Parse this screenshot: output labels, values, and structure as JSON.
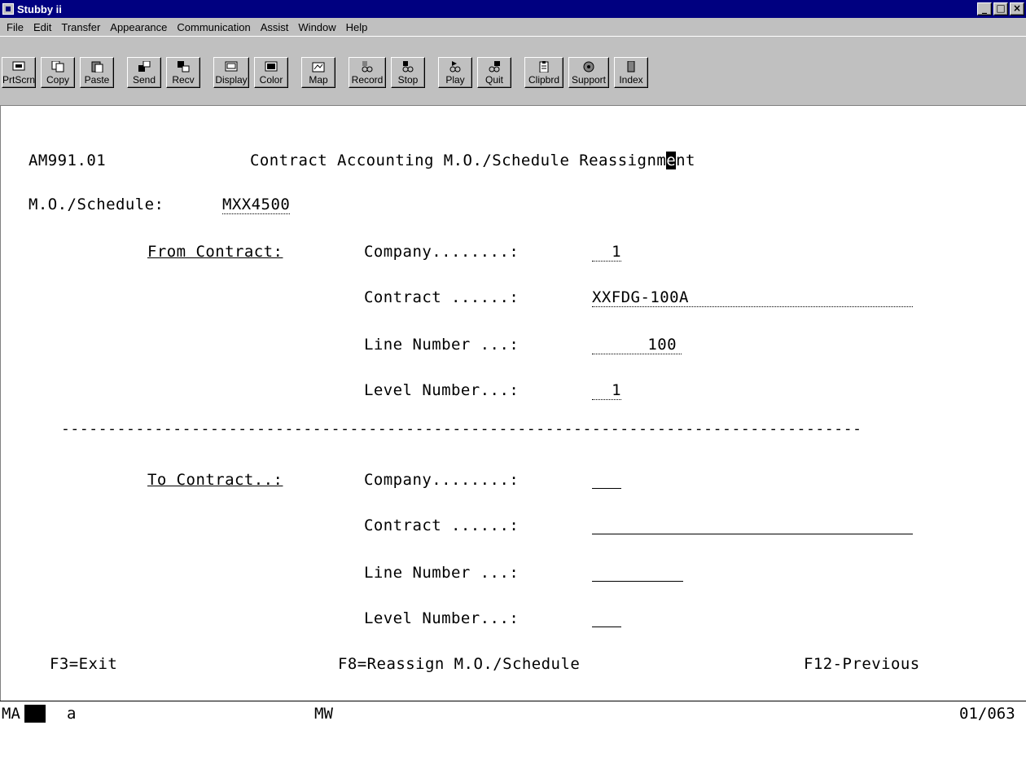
{
  "window": {
    "title": "Stubby ii",
    "controls": [
      "_",
      "□",
      "×"
    ]
  },
  "menu": [
    "File",
    "Edit",
    "Transfer",
    "Appearance",
    "Communication",
    "Assist",
    "Window",
    "Help"
  ],
  "toolbar": [
    {
      "label": "PrtScrn",
      "icon": "printscreen-icon"
    },
    {
      "label": "Copy",
      "icon": "copy-icon"
    },
    {
      "label": "Paste",
      "icon": "paste-icon"
    },
    {
      "label": "Send",
      "icon": "send-icon"
    },
    {
      "label": "Recv",
      "icon": "receive-icon"
    },
    {
      "label": "Display",
      "icon": "display-icon"
    },
    {
      "label": "Color",
      "icon": "color-icon"
    },
    {
      "label": "Map",
      "icon": "map-icon"
    },
    {
      "label": "Record",
      "icon": "record-icon"
    },
    {
      "label": "Stop",
      "icon": "stop-icon"
    },
    {
      "label": "Play",
      "icon": "play-icon"
    },
    {
      "label": "Quit",
      "icon": "quit-icon"
    },
    {
      "label": "Clipbrd",
      "icon": "clipboard-icon"
    },
    {
      "label": "Support",
      "icon": "support-icon"
    },
    {
      "label": "Index",
      "icon": "index-icon"
    }
  ],
  "screen": {
    "program_id": "AM991.01",
    "title_before_cursor": "Contract Accounting M.O./Schedule Reassignm",
    "title_cursor_char": "e",
    "title_after_cursor": "nt",
    "mo_schedule_label": "M.O./Schedule:",
    "mo_schedule_value": "MXX4500",
    "from_contract_label": "From Contract:",
    "to_contract_label": "To Contract..:",
    "company_label": "Company........:",
    "contract_label": "Contract ......:",
    "line_number_label": "Line Number ...:",
    "level_number_label": "Level Number...:",
    "from_company_value": "1",
    "from_contract_value": "XXFDG-100A",
    "from_line_number_value": "100",
    "from_level_number_value": "1",
    "separator": "--------------------------------------------------------------------------------------",
    "fkey_exit": "F3=Exit",
    "fkey_reassign": "F8=Reassign M.O./Schedule",
    "fkey_previous": "F12-Previous"
  },
  "status": {
    "session": "MA",
    "mode": "a",
    "indicator": "MW",
    "position": "01/063"
  }
}
